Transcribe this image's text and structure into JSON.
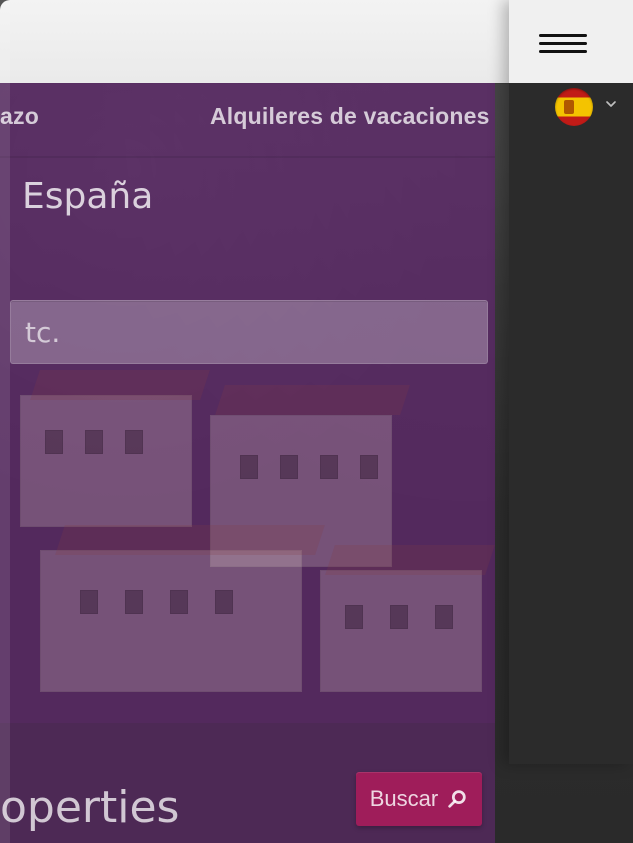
{
  "nav": {
    "left_item": "azo",
    "right_item": "Alquileres de vacaciones"
  },
  "hero": {
    "title": "España",
    "search_placeholder": "tc.",
    "search_value": ""
  },
  "bottom": {
    "title_fragment": "operties",
    "search_button_label": "Buscar"
  },
  "icons": {
    "menu": "hamburger-menu-icon",
    "language": "spain-flag-icon",
    "dropdown": "chevron-down-icon",
    "search": "search-icon"
  },
  "colors": {
    "overlay_purple": "#622870",
    "button_magenta": "#9f1d5a",
    "header_bg": "#f0f0f0",
    "drawer_bg": "#2b2b2b"
  }
}
